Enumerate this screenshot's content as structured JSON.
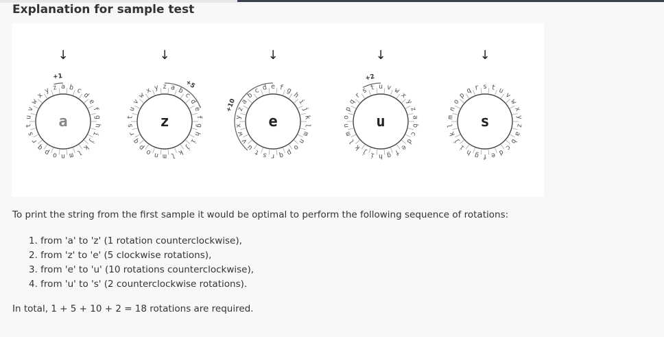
{
  "section": {
    "title": "Explanation for sample test"
  },
  "figure": {
    "alphabet": "abcdefghijklmnopqrstuvwxyz",
    "wheels": [
      {
        "letter": "a",
        "rotation": "+1",
        "steps": 1,
        "direction": "ccw"
      },
      {
        "letter": "z",
        "rotation": "+5",
        "steps": 5,
        "direction": "cw"
      },
      {
        "letter": "e",
        "rotation": "+10",
        "steps": 10,
        "direction": "ccw"
      },
      {
        "letter": "u",
        "rotation": "+2",
        "steps": 2,
        "direction": "ccw"
      },
      {
        "letter": "s",
        "rotation": "",
        "steps": 0,
        "direction": ""
      }
    ],
    "arrow_glyph": "↓"
  },
  "text": {
    "intro": "To print the string from the first sample it would be optimal to perform the following sequence of rotations:",
    "steps": [
      "1. from 'a' to 'z' (1 rotation counterclockwise),",
      "2. from 'z' to 'e' (5 clockwise rotations),",
      "3. from 'e' to 'u' (10 rotations counterclockwise),",
      "4. from 'u' to 's' (2 counterclockwise rotations)."
    ],
    "total": "In total, 1 + 5 + 10 + 2 = 18 rotations are required."
  }
}
